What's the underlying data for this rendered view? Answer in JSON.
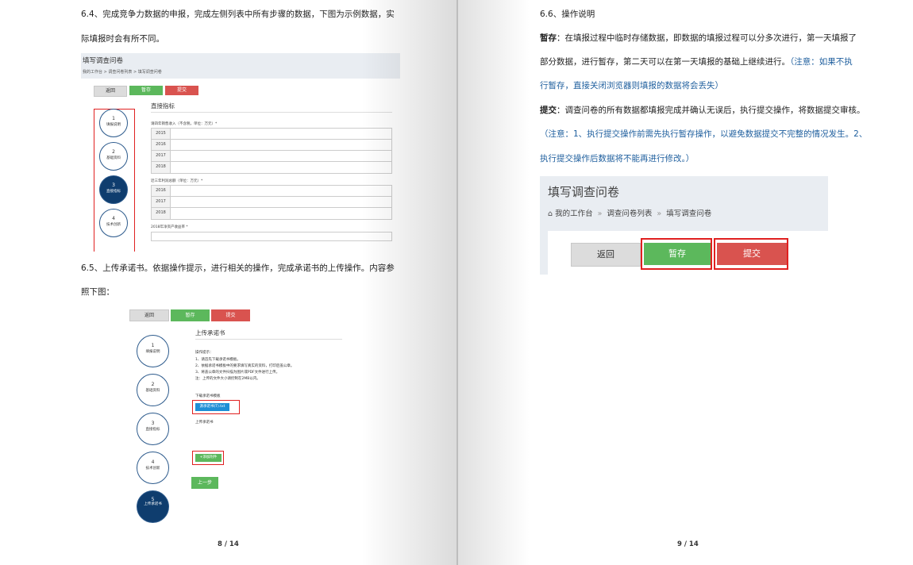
{
  "left_page": {
    "para_64_line1": "6.4、完成竞争力数据的申报，完成左侧列表中所有步骤的数据，下图为示例数据，实",
    "para_64_line2": "际填报时会有所不同。",
    "para_65_line1": "6.5、上传承诺书。依据操作提示，进行相关的操作，完成承诺书的上传操作。内容参",
    "para_65_line2": "照下图：",
    "page_number": "8 / 14",
    "figure1": {
      "title": "填写调查问卷",
      "breadcrumb": "我的工作台 > 调查问卷列表 > 填写调查问卷",
      "buttons": {
        "back": "返回",
        "save": "暂存",
        "submit": "提交"
      },
      "steps": [
        {
          "num": "1",
          "label": "填报说明"
        },
        {
          "num": "2",
          "label": "基础资料"
        },
        {
          "num": "3",
          "label": "直接指标"
        },
        {
          "num": "4",
          "label": "技术创新"
        }
      ],
      "section_title": "直接指标",
      "field1_label": "请四年销售收入（不含税，单位：万元）*",
      "field1_years": [
        "2015",
        "2016",
        "2017",
        "2018"
      ],
      "field2_label": "近三年利润总额（单位：万元）*",
      "field2_years": [
        "2016",
        "2017",
        "2018"
      ],
      "field3_label": "2018年净资产收益率 *"
    },
    "figure2": {
      "buttons": {
        "back": "返回",
        "save": "暂存",
        "submit": "提交"
      },
      "steps": [
        {
          "num": "1",
          "label": "填报说明"
        },
        {
          "num": "2",
          "label": "基础资料"
        },
        {
          "num": "3",
          "label": "直接指标"
        },
        {
          "num": "4",
          "label": "技术创新"
        },
        {
          "num": "5",
          "label": "上传承诺书"
        }
      ],
      "section_title": "上传承诺书",
      "instructions_title": "操作提示：",
      "instructions": [
        "1、请首先下载承诺书模板。",
        "2、依据承诺书模板中的要求填写真实的资料，打印后盖公章。",
        "3、将盖公章的文件扫描为图片或PDF文件进行上传。",
        "注：上传的文件大小请控制在2MB以内。"
      ],
      "download_label": "下载承诺书模板",
      "download_button": "源承诺书(T).txt",
      "upload_label": "上传承诺书",
      "add_file_button": "+添加附件",
      "prev_button": "上一步"
    }
  },
  "right_page": {
    "heading": "6.6、操作说明",
    "save_term": "暂存",
    "save_desc_1": "：在填报过程中临时存储数据，即数据的填报过程可以分多次进行，第一天填报了",
    "save_desc_2": "部分数据，进行暂存，第二天可以在第一天填报的基础上继续进行。",
    "save_note_1": "（注意：如果不执",
    "save_note_2": "行暂存，直接关闭浏览器则填报的数据将会丢失）",
    "submit_term": "提交",
    "submit_desc": "：调查问卷的所有数据都填报完成并确认无误后，执行提交操作，将数据提交审核。",
    "submit_note_1": "（注意：1、执行提交操作前需先执行暂存操作，以避免数据提交不完整的情况发生。2、",
    "submit_note_2": "执行提交操作后数据将不能再进行修改。）",
    "page_number": "9 / 14",
    "figure3": {
      "title": "填写调查问卷",
      "breadcrumb": [
        "我的工作台",
        "调查问卷列表",
        "填写调查问卷"
      ],
      "back": "返回",
      "save": "暂存",
      "submit": "提交"
    }
  },
  "colors": {
    "save_green": "#5cb85c",
    "submit_red": "#d9534f",
    "step_active": "#0f3d6e",
    "note_blue": "#1f5f9e",
    "highlight_red": "#e02020"
  }
}
